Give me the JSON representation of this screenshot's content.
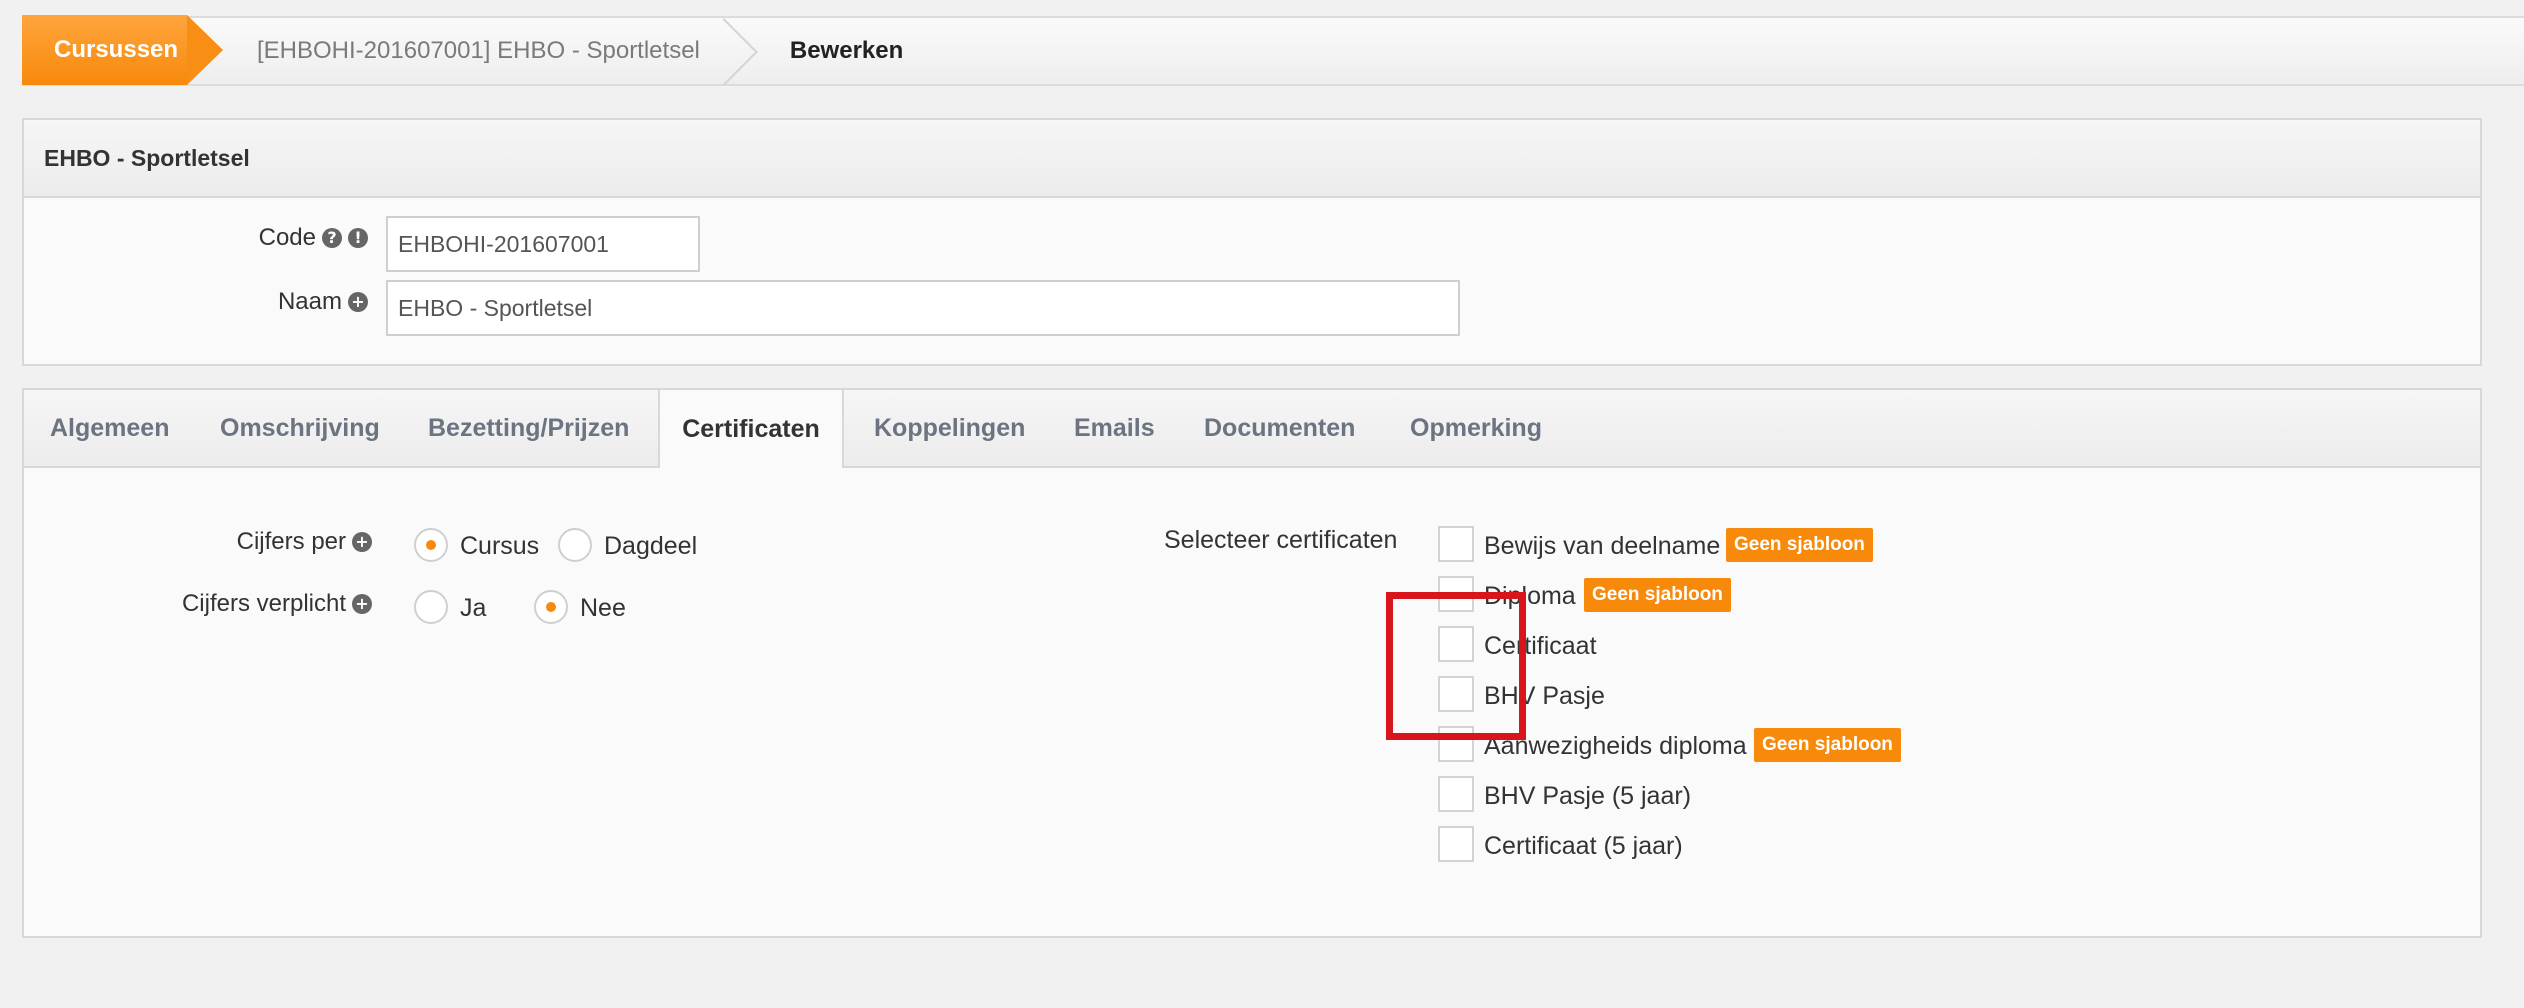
{
  "breadcrumb": {
    "first": "Cursussen",
    "middle": "[EHBOHI-201607001] EHBO - Sportletsel",
    "last": "Bewerken"
  },
  "header_panel": {
    "title": "EHBO - Sportletsel",
    "code_label": "Code",
    "code_value": "EHBOHI-201607001",
    "naam_label": "Naam",
    "naam_value": "EHBO - Sportletsel"
  },
  "tabs": [
    "Algemeen",
    "Omschrijving",
    "Bezetting/Prijzen",
    "Certificaten",
    "Koppelingen",
    "Emails",
    "Documenten",
    "Opmerking"
  ],
  "active_tab": "Certificaten",
  "certificaten": {
    "cijfers_per_label": "Cijfers per",
    "cijfers_per_options": [
      "Cursus",
      "Dagdeel"
    ],
    "cijfers_per_selected": "Cursus",
    "cijfers_verplicht_label": "Cijfers verplicht",
    "cijfers_verplicht_options": [
      "Ja",
      "Nee"
    ],
    "cijfers_verplicht_selected": "Nee",
    "selecteer_label": "Selecteer certificaten",
    "items": [
      {
        "label": "Bewijs van deelname",
        "badge": "Geen sjabloon"
      },
      {
        "label": "Diploma",
        "badge": "Geen sjabloon"
      },
      {
        "label": "Certificaat",
        "badge": ""
      },
      {
        "label": "BHV Pasje",
        "badge": ""
      },
      {
        "label": "Aanwezigheids diploma",
        "badge": "Geen sjabloon"
      },
      {
        "label": "BHV Pasje (5 jaar)",
        "badge": ""
      },
      {
        "label": "Certificaat (5 jaar)",
        "badge": ""
      }
    ]
  },
  "colors": {
    "accent": "#f7890b",
    "highlight": "#d9151c"
  }
}
